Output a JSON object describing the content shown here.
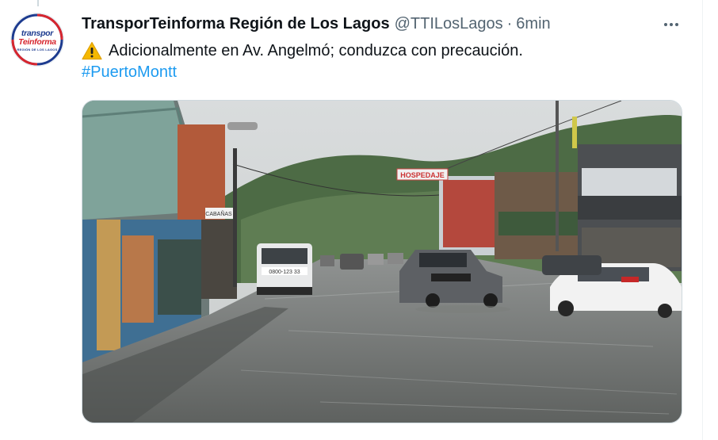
{
  "tweet": {
    "avatar": {
      "line1": "transpor",
      "line2": "Teinforma",
      "line3": "REGIÓN DE LOS LAGOS"
    },
    "display_name": "TransporTeinforma Región de Los Lagos",
    "handle": "@TTILosLagos",
    "separator": "·",
    "time": "6min",
    "text": "Adicionalmente en Av. Angelmó; conduzca con precaución.",
    "hashtag": "#PuertoMontt",
    "media": {
      "signs": {
        "hospedaje": "HOSPEDAJE",
        "cabanas": "CABAÑAS",
        "van_plate": "0800-123 33"
      }
    }
  },
  "colors": {
    "link": "#1d9bf0",
    "secondary_text": "#536471",
    "primary_text": "#0f1419",
    "brand_blue": "#1d3b8f",
    "brand_red": "#d7262e"
  },
  "icons": {
    "warning": "warning-icon",
    "more": "more-icon"
  }
}
